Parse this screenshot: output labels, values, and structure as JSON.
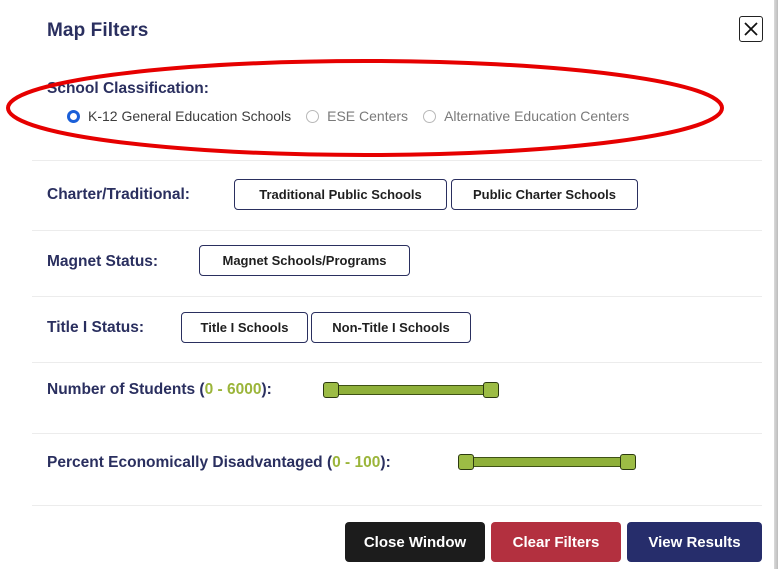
{
  "modal": {
    "title": "Map Filters",
    "close_icon": "close-x-icon"
  },
  "classification": {
    "label": "School Classification:",
    "options": [
      {
        "label": "K-12 General Education Schools",
        "checked": true
      },
      {
        "label": "ESE Centers",
        "checked": false
      },
      {
        "label": "Alternative Education Centers",
        "checked": false
      }
    ]
  },
  "charter": {
    "label": "Charter/Traditional:",
    "buttons": [
      "Traditional Public Schools",
      "Public Charter Schools"
    ]
  },
  "magnet": {
    "label": "Magnet Status:",
    "buttons": [
      "Magnet Schools/Programs"
    ]
  },
  "title1": {
    "label": "Title I Status:",
    "buttons": [
      "Title I Schools",
      "Non-Title I Schools"
    ]
  },
  "students": {
    "label_prefix": "Number of Students (",
    "min": "0",
    "sep": " - ",
    "max": "6000",
    "label_suffix": "):",
    "range_min": 0,
    "range_max": 6000,
    "value_low": 0,
    "value_high": 6000
  },
  "econ": {
    "label_prefix": "Percent Economically Disadvantaged (",
    "min": "0",
    "sep": " - ",
    "max": "100",
    "label_suffix": "):",
    "range_min": 0,
    "range_max": 100,
    "value_low": 0,
    "value_high": 100
  },
  "footer": {
    "close_label": "Close Window",
    "clear_label": "Clear Filters",
    "view_label": "View Results"
  },
  "colors": {
    "heading": "#2a2f5f",
    "accent_green": "#9bb53a",
    "close_btn": "#1c1c1c",
    "clear_btn": "#b3303f",
    "view_btn": "#262d6b",
    "highlight": "#e60000"
  }
}
